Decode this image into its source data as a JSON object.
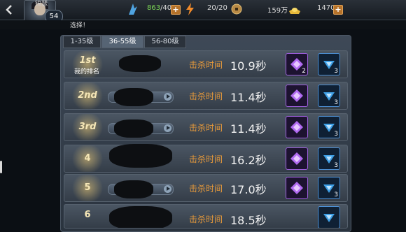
{
  "header": {
    "player_name": "锦瑟",
    "player_level": "54",
    "stamina": "863",
    "stamina_max": "/40",
    "energy": "20/20",
    "coins": "159万",
    "gold": "1470",
    "plus_symbol": "+"
  },
  "subheader": {
    "text": "选择！"
  },
  "tabs": [
    {
      "label": "1-35级"
    },
    {
      "label": "36-55级"
    },
    {
      "label": "56-80级"
    }
  ],
  "rows": [
    {
      "rank": "1st",
      "rank_subtitle": "我的排名",
      "kill_label": "击杀时间",
      "kill_time": "10.9秒",
      "purple_qty": "2",
      "blue_qty": "3"
    },
    {
      "rank": "2nd",
      "kill_label": "击杀时间",
      "kill_time": "11.4秒",
      "purple_qty": "",
      "blue_qty": "3"
    },
    {
      "rank": "3rd",
      "kill_label": "击杀时间",
      "kill_time": "11.4秒",
      "purple_qty": "",
      "blue_qty": "3"
    },
    {
      "rank": "4",
      "kill_label": "击杀时间",
      "kill_time": "16.2秒",
      "purple_qty": "",
      "blue_qty": "3"
    },
    {
      "rank": "5",
      "kill_label": "击杀时间",
      "kill_time": "17.0秒",
      "purple_qty": "",
      "blue_qty": "3"
    },
    {
      "rank": "6",
      "kill_label": "击杀时间",
      "kill_time": "18.5秒",
      "purple_qty": "",
      "blue_qty": ""
    }
  ],
  "colors": {
    "accent_orange": "#e89a3a",
    "gem_purple": "#a060e0",
    "gem_blue": "#4e91d6"
  }
}
